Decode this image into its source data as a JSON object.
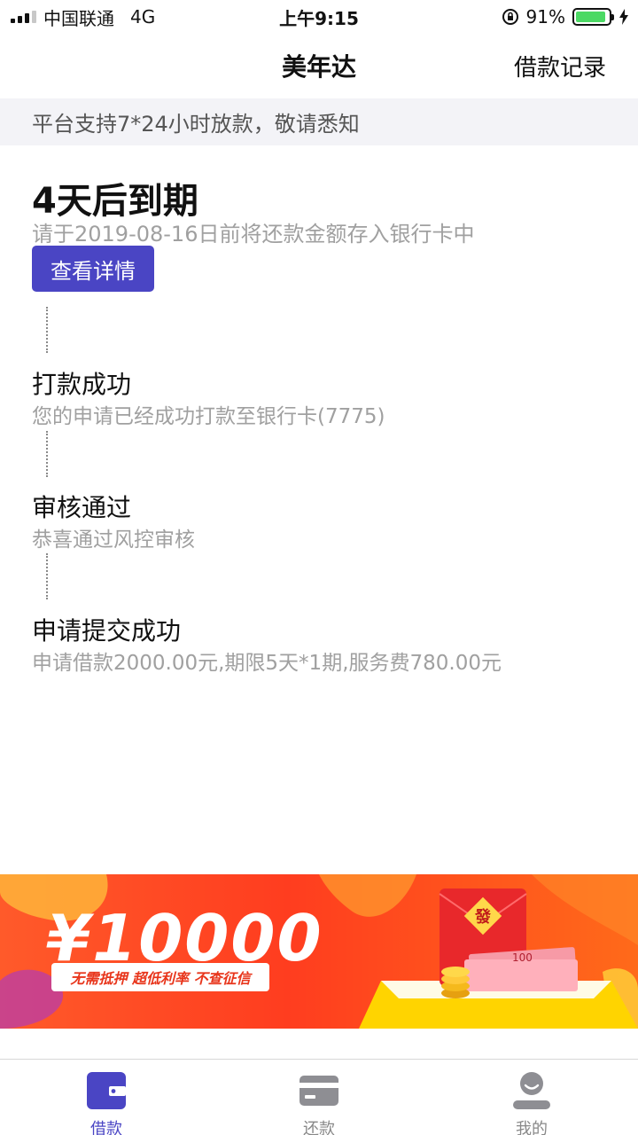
{
  "status_bar": {
    "carrier": "中国联通",
    "network": "4G",
    "time": "上午9:15",
    "battery_percent": "91%",
    "battery_level": 0.91,
    "signal_bars_active": 3
  },
  "nav": {
    "title": "美年达",
    "action_label": "借款记录"
  },
  "notice": "平台支持7*24小时放款，敬请悉知",
  "due": {
    "title": "4天后到期",
    "desc": "请于2019-08-16日前将还款金额存入银行卡中",
    "button": "查看详情"
  },
  "steps": [
    {
      "title": "打款成功",
      "desc": "您的申请已经成功打款至银行卡(7775)"
    },
    {
      "title": "审核通过",
      "desc": "恭喜通过风控审核"
    },
    {
      "title": "申请提交成功",
      "desc": "申请借款2000.00元,期限5天*1期,服务费780.00元"
    }
  ],
  "banner": {
    "amount": "¥10000",
    "tags": "无需抵押  超低利率  不查征信",
    "envelope_char": "發",
    "note_value": "100"
  },
  "tabs": [
    {
      "label": "借款",
      "icon": "wallet-icon",
      "active": true
    },
    {
      "label": "还款",
      "icon": "card-icon",
      "active": false
    },
    {
      "label": "我的",
      "icon": "user-icon",
      "active": false
    }
  ],
  "colors": {
    "accent": "#4a45c4",
    "notice_bg": "#f3f3f7",
    "banner_orange": "#ff4a22",
    "battery_green": "#4cd964"
  }
}
